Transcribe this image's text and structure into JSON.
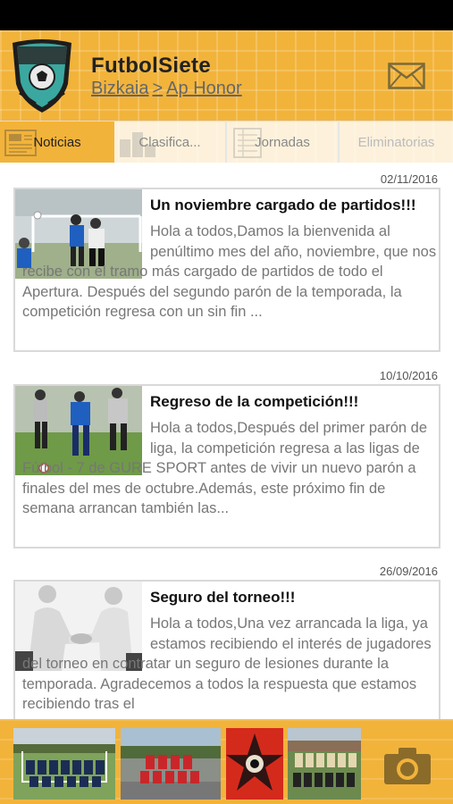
{
  "app": {
    "title": "FutbolSiete",
    "region": "Bizkaia",
    "separator": ">",
    "league": "Ap Honor"
  },
  "tabs": [
    {
      "label": "Noticias",
      "active": true
    },
    {
      "label": "Clasifica...",
      "active": false
    },
    {
      "label": "Jornadas",
      "active": false
    },
    {
      "label": "Eliminatorias",
      "active": false
    }
  ],
  "news": [
    {
      "date": "02/11/2016",
      "title": "Un noviembre cargado de partidos!!!",
      "body": "Hola a todos,Damos la bienvenida al penúltimo mes del año, noviembre, que nos recibe con el tramo más cargado de partidos de todo el Apertura. Después del segundo parón de la temporada, la competición regresa con un sin fin ..."
    },
    {
      "date": "10/10/2016",
      "title": "Regreso de la competición!!!",
      "body": "Hola a todos,Después del primer parón de liga, la competición regresa a las ligas de Fútbol - 7 de GURE SPORT antes de vivir un nuevo parón a finales del mes de octubre.Además, este próximo fin de semana arrancan también las..."
    },
    {
      "date": "26/09/2016",
      "title": "Seguro del torneo!!!",
      "body": "Hola a todos,Una vez arrancada la liga, ya estamos recibiendo el interés de jugadores del torneo en contratar un seguro de lesiones durante la temporada. Agradecemos a todos la respuesta que estamos recibiendo tras el"
    }
  ],
  "icons": {
    "mail": "envelope-icon",
    "camera": "camera-icon",
    "logo": "shield-logo"
  },
  "colors": {
    "brand": "#f2b33a",
    "logo_teal": "#3aa8a0",
    "text_muted": "#777777"
  }
}
